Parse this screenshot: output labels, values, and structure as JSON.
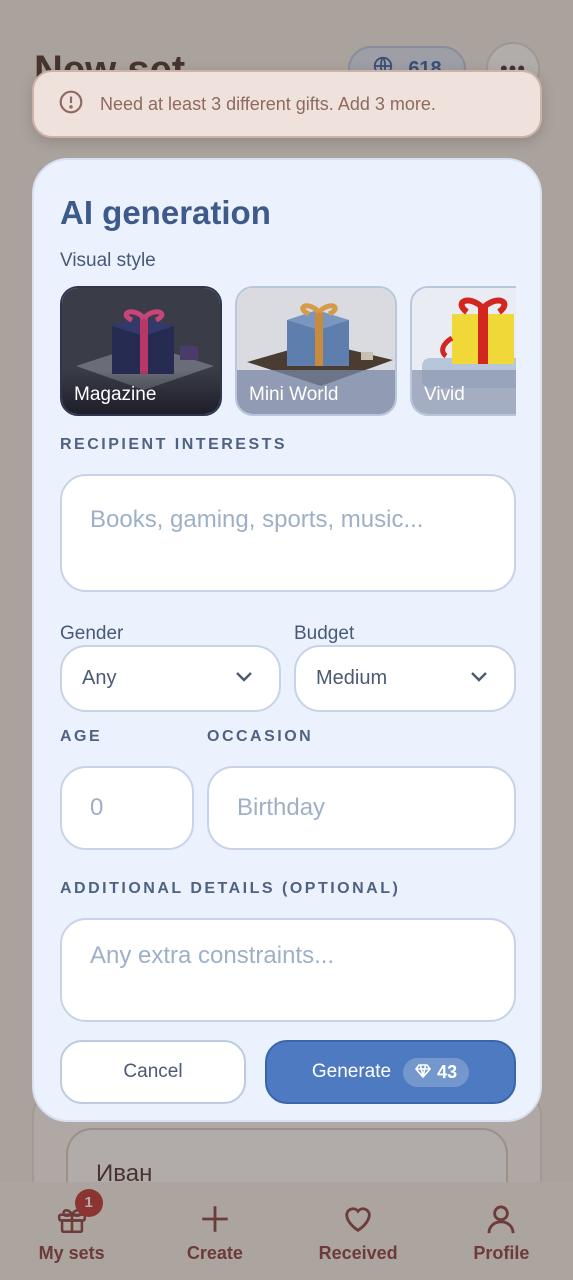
{
  "background": {
    "page_title": "New set",
    "credits": "618",
    "more_glyph": "•••",
    "recipient_name": "Иван"
  },
  "bottom_nav": [
    {
      "label": "My sets",
      "icon": "gift-icon",
      "badge": "1"
    },
    {
      "label": "Create",
      "icon": "plus-icon"
    },
    {
      "label": "Received",
      "icon": "heart-icon"
    },
    {
      "label": "Profile",
      "icon": "person-icon"
    }
  ],
  "toast": {
    "message": "Need at least 3 different gifts. Add 3 more.",
    "icon": "info-circle-icon"
  },
  "dialog": {
    "title": "AI generation",
    "visual_style_label": "Visual style",
    "styles": [
      {
        "label": "Magazine",
        "selected": true
      },
      {
        "label": "Mini World",
        "selected": false
      },
      {
        "label": "Vivid",
        "selected": false
      }
    ],
    "interests_label": "RECIPIENT INTERESTS",
    "interests_placeholder": "Books, gaming, sports, music...",
    "gender_label": "Gender",
    "gender_value": "Any",
    "budget_label": "Budget",
    "budget_value": "Medium",
    "age_label": "AGE",
    "age_placeholder": "0",
    "occasion_label": "OCCASION",
    "occasion_placeholder": "Birthday",
    "details_label": "ADDITIONAL DETAILS (OPTIONAL)",
    "details_placeholder": "Any extra constraints...",
    "cancel_label": "Cancel",
    "generate_label": "Generate",
    "generate_cost": "43"
  },
  "colors": {
    "accent": "#4d7ac0",
    "dialog_bg": "#ecf2fd",
    "brand_text": "#8a3b3b",
    "badge": "#c0302e"
  }
}
